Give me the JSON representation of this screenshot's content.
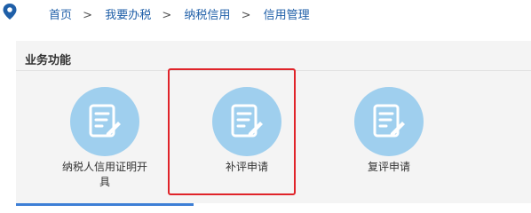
{
  "breadcrumb": {
    "items": [
      "首页",
      "我要办税",
      "纳税信用",
      "信用管理"
    ],
    "separator": ">"
  },
  "panel": {
    "title": "业务功能",
    "items": [
      {
        "label": "纳税人信用证明开具",
        "icon": "edit-document-icon"
      },
      {
        "label": "补评申请",
        "icon": "edit-document-icon"
      },
      {
        "label": "复评申请",
        "icon": "edit-document-icon"
      }
    ]
  },
  "colors": {
    "accent": "#1f5fa8",
    "icon_bg": "#9fcfee",
    "highlight": "#e0242a",
    "panel_bg": "#f4f4f4"
  }
}
